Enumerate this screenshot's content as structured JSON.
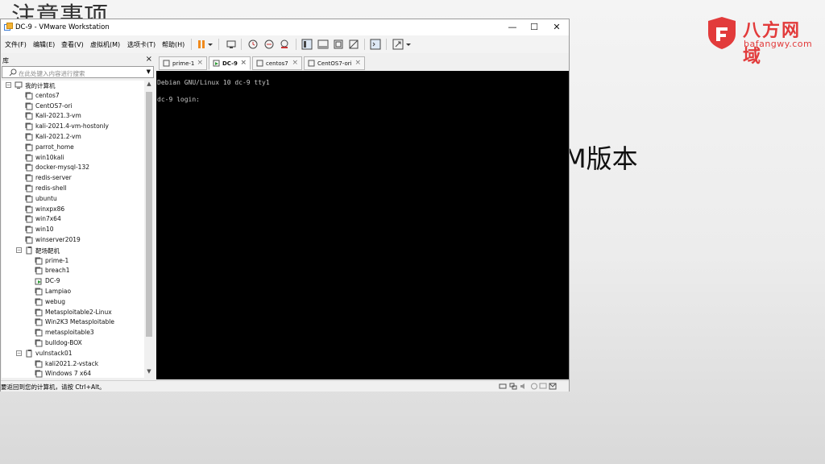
{
  "slide": {
    "title_partial": "注意事项",
    "body_fragment": "M版本"
  },
  "brand": {
    "name": "八方网域",
    "domain": "bafangwy.com",
    "color": "#e23b3b"
  },
  "window": {
    "title": "DC-9 - VMware Workstation",
    "controls": {
      "minimize": "—",
      "maximize": "☐",
      "close": "✕"
    }
  },
  "menu": [
    "文件(F)",
    "编辑(E)",
    "查看(V)",
    "虚拟机(M)",
    "选项卡(T)",
    "帮助(H)"
  ],
  "toolbar": {
    "icons": [
      "pause-icon",
      "dropdown-icon",
      "send-keys-icon",
      "snapshot-icon",
      "revert-snapshot-icon",
      "manage-snapshots-icon",
      "library-view-icon",
      "thumbnail-view-icon",
      "fullscreen-icon",
      "unity-icon",
      "console-icon",
      "stretch-icon"
    ],
    "pause_color": "#f08a1c"
  },
  "library": {
    "title": "库",
    "close": "×",
    "search_placeholder": "在此处键入内容进行搜索",
    "tree": {
      "root": "我的计算机",
      "root_vms": [
        "centos7",
        "CentOS7-ori",
        "Kali-2021.3-vm",
        "kali-2021.4-vm-hostonly",
        "Kali-2021.2-vm",
        "parrot_home",
        "win10kali",
        "docker-mysql-132",
        "redis-server",
        "redis-shell",
        "ubuntu",
        "winxpx86",
        "win7x64",
        "win10",
        "winserver2019"
      ],
      "folder1": "靶场靶机",
      "folder1_vms": [
        "prime-1",
        "breach1",
        "DC-9",
        "Lampiao",
        "webug",
        "Metasploitable2-Linux",
        "Win2K3 Metasploitable",
        "metasploitable3",
        "bulldog-BOX"
      ],
      "folder2": "vulnstack01",
      "folder2_vms": [
        "kali2021.2-vstack",
        "Windows 7 x64"
      ],
      "running_vm": "DC-9"
    }
  },
  "tabs": [
    {
      "label": "prime-1",
      "active": false
    },
    {
      "label": "DC-9",
      "active": true
    },
    {
      "label": "centos7",
      "active": false
    },
    {
      "label": "CentOS7-ori",
      "active": false
    }
  ],
  "console": {
    "lines": [
      "Debian GNU/Linux 10 dc-9 tty1",
      "dc-9 login:"
    ]
  },
  "statusbar": {
    "text": "要返回到您的计算机，请按 Ctrl+Alt。",
    "icons": [
      "hdd-icon",
      "network-icon",
      "sound-icon",
      "usb-icon",
      "display-icon"
    ]
  }
}
